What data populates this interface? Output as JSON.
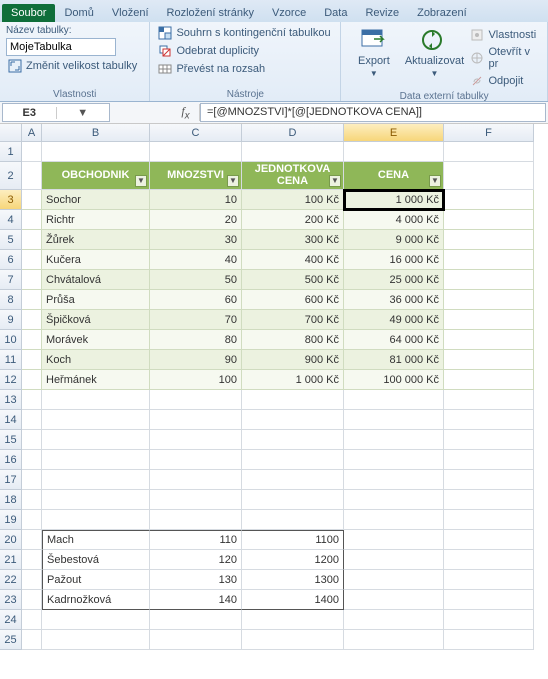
{
  "tabs": [
    "Soubor",
    "Domů",
    "Vložení",
    "Rozložení stránky",
    "Vzorce",
    "Data",
    "Revize",
    "Zobrazení"
  ],
  "active_tab_index": 0,
  "ribbon": {
    "group1_label": "Vlastnosti",
    "table_name_label": "Název tabulky:",
    "table_name_value": "MojeTabulka",
    "resize_label": "Změnit velikost tabulky",
    "group2_label": "Nástroje",
    "pivot_summary": "Souhrn s kontingenční tabulkou",
    "remove_dup": "Odebrat duplicity",
    "to_range": "Převést na rozsah",
    "export": "Export",
    "refresh": "Aktualizovat",
    "group3_label": "Data externí tabulky",
    "props": "Vlastnosti",
    "open_browser": "Otevřít v pr",
    "unlink": "Odpojit"
  },
  "namebox": "E3",
  "formula": "=[@MNOZSTVI]*[@[JEDNOTKOVA CENA]]",
  "cols": [
    "A",
    "B",
    "C",
    "D",
    "E",
    "F"
  ],
  "row_count": 25,
  "selected_row": 3,
  "selected_col": "E",
  "table_headers": [
    "OBCHODNIK",
    "MNOZSTVI",
    "JEDNOTKOVA CENA",
    "CENA"
  ],
  "chart_data": {
    "type": "table",
    "columns": [
      "OBCHODNIK",
      "MNOZSTVI",
      "JEDNOTKOVA CENA",
      "CENA"
    ],
    "rows": [
      {
        "obchodnik": "Sochor",
        "mnozstvi": 10,
        "jc": "100 Kč",
        "cena": "1 000 Kč"
      },
      {
        "obchodnik": "Richtr",
        "mnozstvi": 20,
        "jc": "200 Kč",
        "cena": "4 000 Kč"
      },
      {
        "obchodnik": "Žůrek",
        "mnozstvi": 30,
        "jc": "300 Kč",
        "cena": "9 000 Kč"
      },
      {
        "obchodnik": "Kučera",
        "mnozstvi": 40,
        "jc": "400 Kč",
        "cena": "16 000 Kč"
      },
      {
        "obchodnik": "Chvátalová",
        "mnozstvi": 50,
        "jc": "500 Kč",
        "cena": "25 000 Kč"
      },
      {
        "obchodnik": "Průša",
        "mnozstvi": 60,
        "jc": "600 Kč",
        "cena": "36 000 Kč"
      },
      {
        "obchodnik": "Špičková",
        "mnozstvi": 70,
        "jc": "700 Kč",
        "cena": "49 000 Kč"
      },
      {
        "obchodnik": "Morávek",
        "mnozstvi": 80,
        "jc": "800 Kč",
        "cena": "64 000 Kč"
      },
      {
        "obchodnik": "Koch",
        "mnozstvi": 90,
        "jc": "900 Kč",
        "cena": "81 000 Kč"
      },
      {
        "obchodnik": "Heřmánek",
        "mnozstvi": 100,
        "jc": "1 000 Kč",
        "cena": "100 000 Kč"
      }
    ],
    "extra_rows": [
      {
        "b": "Mach",
        "c": 110,
        "d": 1100
      },
      {
        "b": "Šebestová",
        "c": 120,
        "d": 1200
      },
      {
        "b": "Pažout",
        "c": 130,
        "d": 1300
      },
      {
        "b": "Kadrnožková",
        "c": 140,
        "d": 1400
      }
    ]
  }
}
